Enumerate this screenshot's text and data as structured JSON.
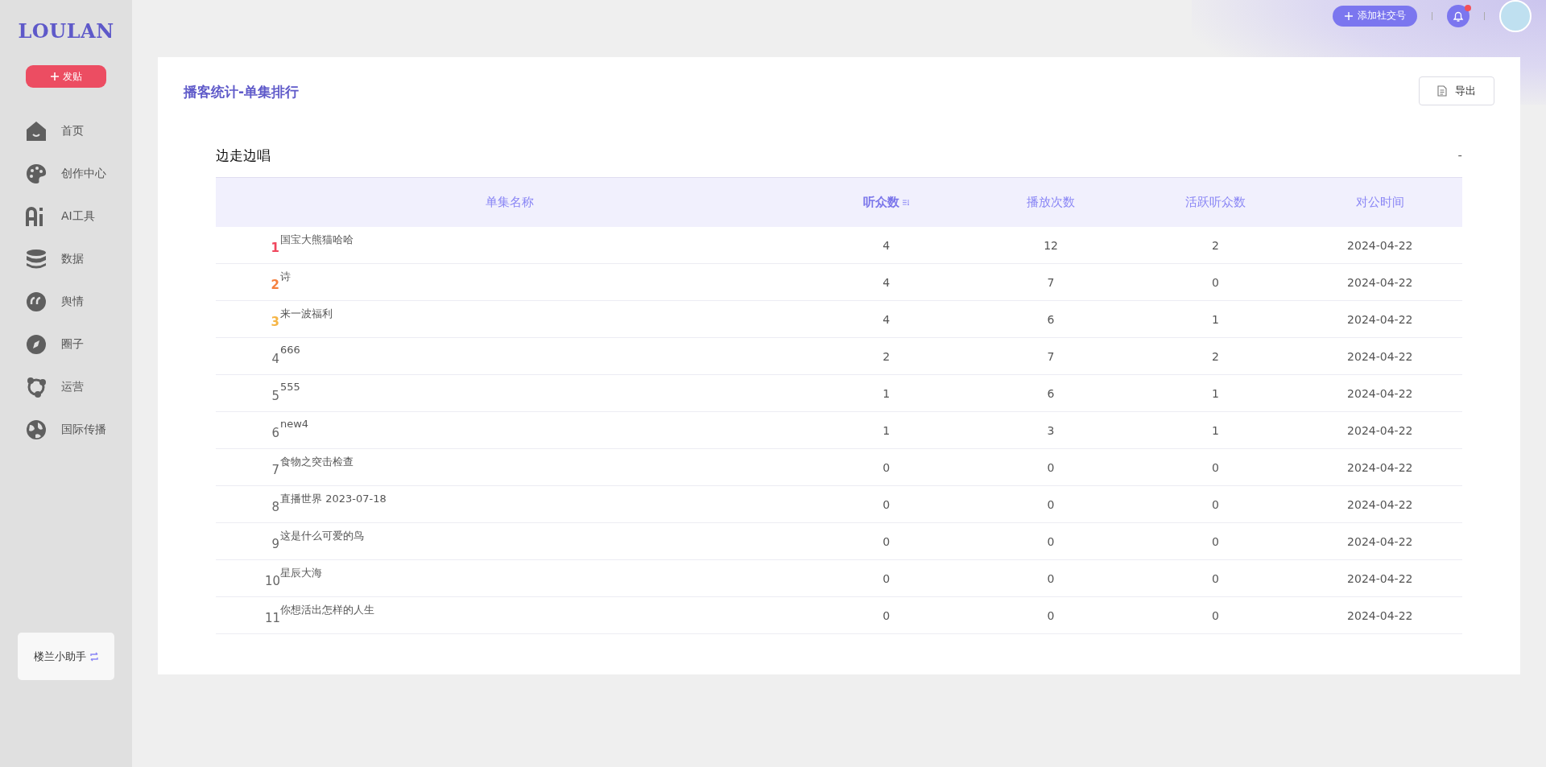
{
  "sidebar": {
    "logo": "LOULAN",
    "post_button": "发贴",
    "items": [
      {
        "label": "首页"
      },
      {
        "label": "创作中心"
      },
      {
        "label": "AI工具"
      },
      {
        "label": "数据"
      },
      {
        "label": "舆情"
      },
      {
        "label": "圈子"
      },
      {
        "label": "运营"
      },
      {
        "label": "国际传播"
      }
    ],
    "assistant": "楼兰小助手"
  },
  "topbar": {
    "add_account_button": "添加社交号",
    "has_notification": true
  },
  "page": {
    "title": "播客统计-单集排行",
    "export_button": "导出"
  },
  "section": {
    "title": "边走边唱",
    "aside": "-"
  },
  "table": {
    "columns": [
      {
        "label": "单集名称",
        "sorted": false
      },
      {
        "label": "听众数",
        "sorted": true
      },
      {
        "label": "播放次数",
        "sorted": false
      },
      {
        "label": "活跃听众数",
        "sorted": false
      },
      {
        "label": "对公时间",
        "sorted": false
      }
    ],
    "rows": [
      {
        "rank": "1",
        "color": "#f0475d",
        "name": "国宝大熊猫哈哈",
        "listeners": "4",
        "plays": "12",
        "active": "2",
        "date": "2024-04-22"
      },
      {
        "rank": "2",
        "color": "#f5803e",
        "name": "诗",
        "listeners": "4",
        "plays": "7",
        "active": "0",
        "date": "2024-04-22"
      },
      {
        "rank": "3",
        "color": "#f5b545",
        "name": "来一波福利",
        "listeners": "4",
        "plays": "6",
        "active": "1",
        "date": "2024-04-22"
      },
      {
        "rank": "4",
        "color": "#666666",
        "name": "666",
        "listeners": "2",
        "plays": "7",
        "active": "2",
        "date": "2024-04-22"
      },
      {
        "rank": "5",
        "color": "#666666",
        "name": "555",
        "listeners": "1",
        "plays": "6",
        "active": "1",
        "date": "2024-04-22"
      },
      {
        "rank": "6",
        "color": "#666666",
        "name": "new4",
        "listeners": "1",
        "plays": "3",
        "active": "1",
        "date": "2024-04-22"
      },
      {
        "rank": "7",
        "color": "#666666",
        "name": "食物之突击检查",
        "listeners": "0",
        "plays": "0",
        "active": "0",
        "date": "2024-04-22"
      },
      {
        "rank": "8",
        "color": "#666666",
        "name": "直播世界 2023-07-18",
        "listeners": "0",
        "plays": "0",
        "active": "0",
        "date": "2024-04-22"
      },
      {
        "rank": "9",
        "color": "#666666",
        "name": "这是什么可爱的鸟",
        "listeners": "0",
        "plays": "0",
        "active": "0",
        "date": "2024-04-22"
      },
      {
        "rank": "10",
        "color": "#666666",
        "name": "星辰大海",
        "listeners": "0",
        "plays": "0",
        "active": "0",
        "date": "2024-04-22"
      },
      {
        "rank": "11",
        "color": "#666666",
        "name": "你想活出怎样的人生",
        "listeners": "0",
        "plays": "0",
        "active": "0",
        "date": "2024-04-22"
      }
    ]
  }
}
